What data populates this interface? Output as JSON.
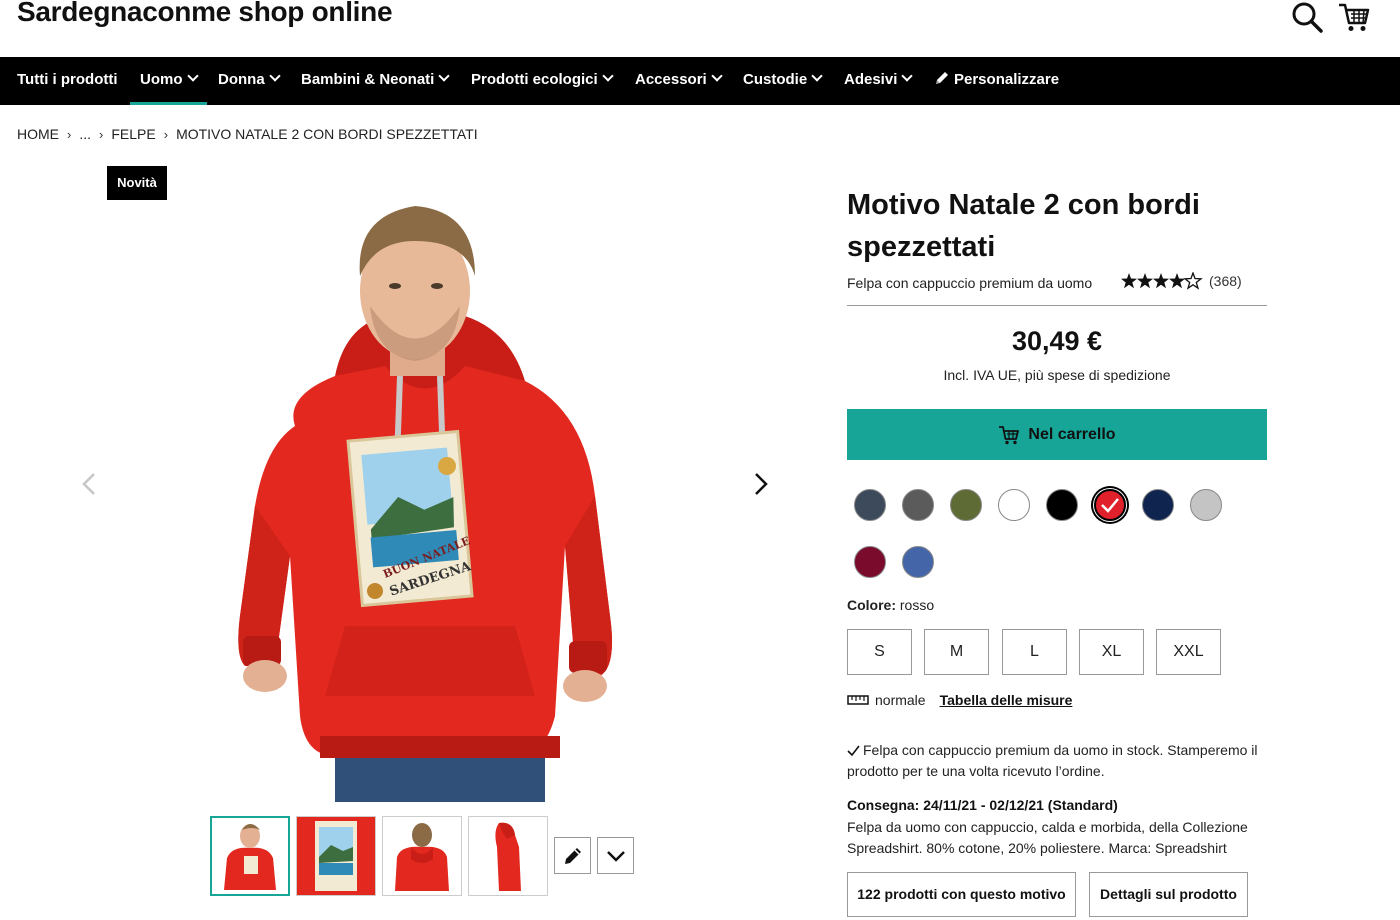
{
  "header": {
    "shop_title": "Sardegnaconme shop online",
    "search_icon": "search-icon",
    "cart_icon": "cart-icon"
  },
  "nav": {
    "items": [
      {
        "label": "Tutti i prodotti"
      },
      {
        "label": "Uomo"
      },
      {
        "label": "Donna"
      },
      {
        "label": "Bambini & Neonati"
      },
      {
        "label": "Prodotti ecologici"
      },
      {
        "label": "Accessori"
      },
      {
        "label": "Custodie"
      },
      {
        "label": "Adesivi"
      },
      {
        "label": "Personalizzare"
      }
    ],
    "active": "Uomo",
    "accent": "#17a598"
  },
  "breadcrumb": {
    "home": "HOME",
    "ellipsis": "...",
    "category": "FELPE",
    "current": "MOTIVO NATALE 2 CON BORDI SPEZZETTATI"
  },
  "badge": "Novità",
  "product": {
    "title": "Motivo Natale 2 con bordi spezzettati",
    "subtitle": "Felpa con cappuccio premium da uomo",
    "rating": 4.5,
    "rating_count": "(368)",
    "price": "30,49 €",
    "price_note": "Incl. IVA UE, più spese di spedizione",
    "cart_label": "Nel carrello",
    "design_text_1": "BUON NATALE",
    "design_text_2": "SARDEGNA"
  },
  "colors": {
    "swatches": [
      {
        "name": "heather-blue",
        "hex": "#3d4a5c"
      },
      {
        "name": "dark-grey",
        "hex": "#5b5b5b"
      },
      {
        "name": "olive",
        "hex": "#5e6b34"
      },
      {
        "name": "white",
        "hex": "#ffffff"
      },
      {
        "name": "black",
        "hex": "#000000"
      },
      {
        "name": "red",
        "hex": "#e0202a"
      },
      {
        "name": "navy",
        "hex": "#0f2550"
      },
      {
        "name": "light-grey",
        "hex": "#c4c4c4"
      },
      {
        "name": "burgundy",
        "hex": "#7a0b2c"
      },
      {
        "name": "royal-blue",
        "hex": "#4466a8"
      }
    ],
    "selected": "red",
    "label": "Colore:",
    "value": "rosso"
  },
  "sizes": [
    "S",
    "M",
    "L",
    "XL",
    "XXL"
  ],
  "fit": {
    "label": "normale",
    "size_chart_link": "Tabella delle misure"
  },
  "stock_note": "Felpa con cappuccio premium da uomo in stock. Stamperemo il prodotto per te una volta ricevuto l’ordine.",
  "delivery": "Consegna: 24/11/21 - 02/12/21 (Standard)",
  "description": "Felpa da uomo con cappuccio, calda e morbida, della Collezione Spreadshirt. 80% cotone, 20% poliestere. Marca: Spreadshirt",
  "bottom_buttons": {
    "related": "122 prodotti con questo motivo",
    "details": "Dettagli sul prodotto"
  }
}
